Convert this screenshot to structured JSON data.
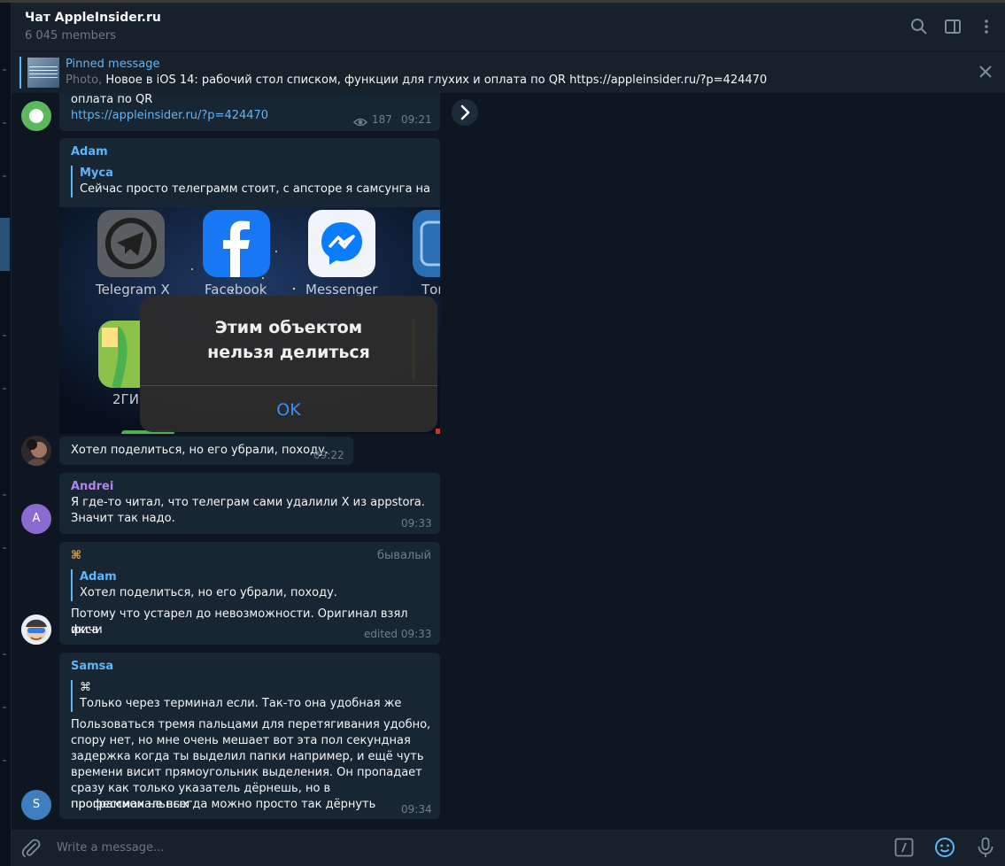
{
  "header": {
    "title": "Чат AppleInsider.ru",
    "members": "6 045 members"
  },
  "pinned": {
    "title": "Pinned message",
    "kind": "Photo, ",
    "text": "Новое в iOS 14: рабочий стол списком, функции для глухих и оплата по QR https://appleinsider.ru/?p=424470"
  },
  "messages": [
    {
      "line": "оплата по QR",
      "link": "https://appleinsider.ru/?p=424470",
      "views": "187",
      "time": "09:21"
    },
    {
      "sender": "Adam",
      "reply_name": "Муса",
      "reply_text": "Сейчас просто телеграмм стоит, с апсторе я самсунга на ай…",
      "photo": {
        "apps": [
          "Telegram X",
          "Facebook",
          "Messenger",
          "Тон",
          "2ГИ"
        ],
        "dialog_line1": "Этим объектом",
        "dialog_line2": "нельзя делиться",
        "dialog_button": "OK"
      }
    },
    {
      "text": "Хотел поделиться, но его убрали, походу.",
      "time": "09:22"
    },
    {
      "sender": "Andrei",
      "avatar_letter": "A",
      "text_line1": "Я где-то читал, что телеграм сами удалили Х из appstora.",
      "text_line2": "Значит так надо.",
      "time": "09:33"
    },
    {
      "sender": "⌘",
      "badge": "бывалый",
      "reply_name": "Adam",
      "reply_text": "Хотел поделиться, но его убрали, походу.",
      "text_line1": "Потому что устарел до невозможности. Оригинал взял фичи",
      "text_line2": "икса",
      "time": "edited 09:33"
    },
    {
      "sender": "Samsa",
      "avatar_letter": "S",
      "reply_name": "⌘",
      "reply_text": "Только через терминал если. Так-то она удобная же",
      "lines": [
        "Пользоваться тремя пальцами для перетягивания удобно,",
        "спору нет, но мне очень мешает вот эта пол секундная",
        "задержка когда ты выделил папки например, и ещё чуть",
        "времени висит прямоугольник выделения. Он пропадает",
        "сразу как только указатель дёрнешь, но в профессиональных",
        "программах не всегда можно просто так дёрнуть"
      ],
      "time": "09:34"
    }
  ],
  "composer": {
    "placeholder": "Write a message..."
  },
  "colors": {
    "background": "#0e1621",
    "panel": "#17212b",
    "bubble": "#182533",
    "accent": "#5eb5f7",
    "andrei": "#b283e8"
  },
  "icons": [
    "search-icon",
    "sidebar-toggle-icon",
    "more-vertical-icon",
    "close-icon",
    "eye-icon",
    "forward-arrow-icon",
    "paperclip-icon",
    "slash-command-icon",
    "emoji-icon",
    "microphone-icon"
  ]
}
